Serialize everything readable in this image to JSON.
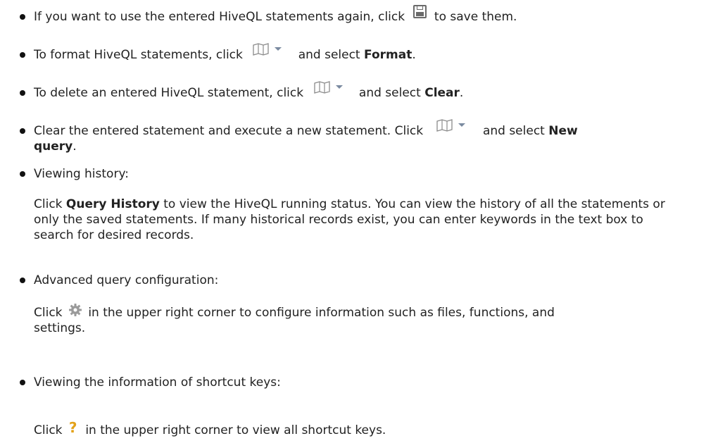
{
  "items": {
    "save": {
      "before": "If you want to use the entered HiveQL statements again, click",
      "after": "to save them.",
      "icon": "save-icon"
    },
    "format": {
      "before": "To format HiveQL statements, click",
      "mid": "and select",
      "bold": "Format",
      "end": ".",
      "icon": "book-dropdown-icon"
    },
    "delete": {
      "before": "To delete an entered HiveQL statement, click",
      "mid": "and select",
      "bold": "Clear",
      "end": ".",
      "icon": "book-dropdown-icon"
    },
    "new_query": {
      "before": "Clear the entered statement and execute a new statement. Click",
      "mid": "and select",
      "bold1": "New",
      "bold2": "query",
      "end": ".",
      "icon": "book-dropdown-icon"
    },
    "history": {
      "title": "Viewing history:",
      "p_before": "Click",
      "p_bold": "Query History",
      "p_after": "to view the HiveQL running status. You can view the history of all the statements or only the saved statements. If many historical records exist, you can enter keywords in the text box to search for desired records."
    },
    "advanced": {
      "title": "Advanced query configuration:",
      "p_before": "Click",
      "p_after1": "in the upper right corner to configure information such as files, functions, and",
      "p_after2": "settings.",
      "icon": "gear-icon"
    },
    "shortcuts": {
      "title": "Viewing the information of shortcut keys:",
      "p_before": "Click",
      "p_after": "in the upper right corner to view all shortcut keys.",
      "icon": "question-icon",
      "icon_glyph": "?"
    }
  },
  "colors": {
    "icon_gray": "#6a6a6a",
    "gear_gray": "#9a9a9a",
    "question_orange": "#e3a21a"
  }
}
